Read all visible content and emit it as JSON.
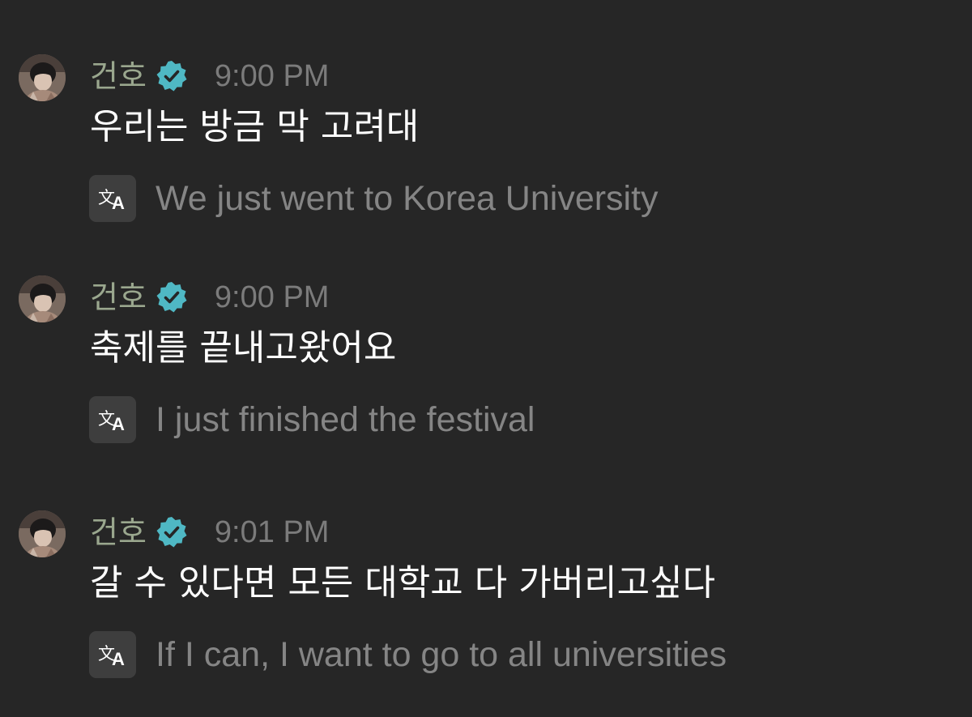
{
  "messages": [
    {
      "sender": "건호",
      "time": "9:00 PM",
      "text": "우리는 방금 막 고려대",
      "translation": "We just went to Korea University"
    },
    {
      "sender": "건호",
      "time": "9:00 PM",
      "text": "축제를 끝내고왔어요",
      "translation": "I just finished the festival"
    },
    {
      "sender": "건호",
      "time": "9:01 PM",
      "text": "갈 수 있다면 모든 대학교 다 가버리고싶다",
      "translation": "If I can, I want to go to all universities"
    }
  ],
  "colors": {
    "background": "#262626",
    "sender_name": "#9aa78e",
    "verified_badge": "#4fb8c4",
    "timestamp": "#7b7b7b",
    "message_text": "#ffffff",
    "translation_text": "#858585",
    "translate_icon_bg": "#3e3e3e"
  },
  "icons": {
    "avatar": "avatar",
    "verified": "verified-badge-icon",
    "translate": "translate-icon"
  }
}
